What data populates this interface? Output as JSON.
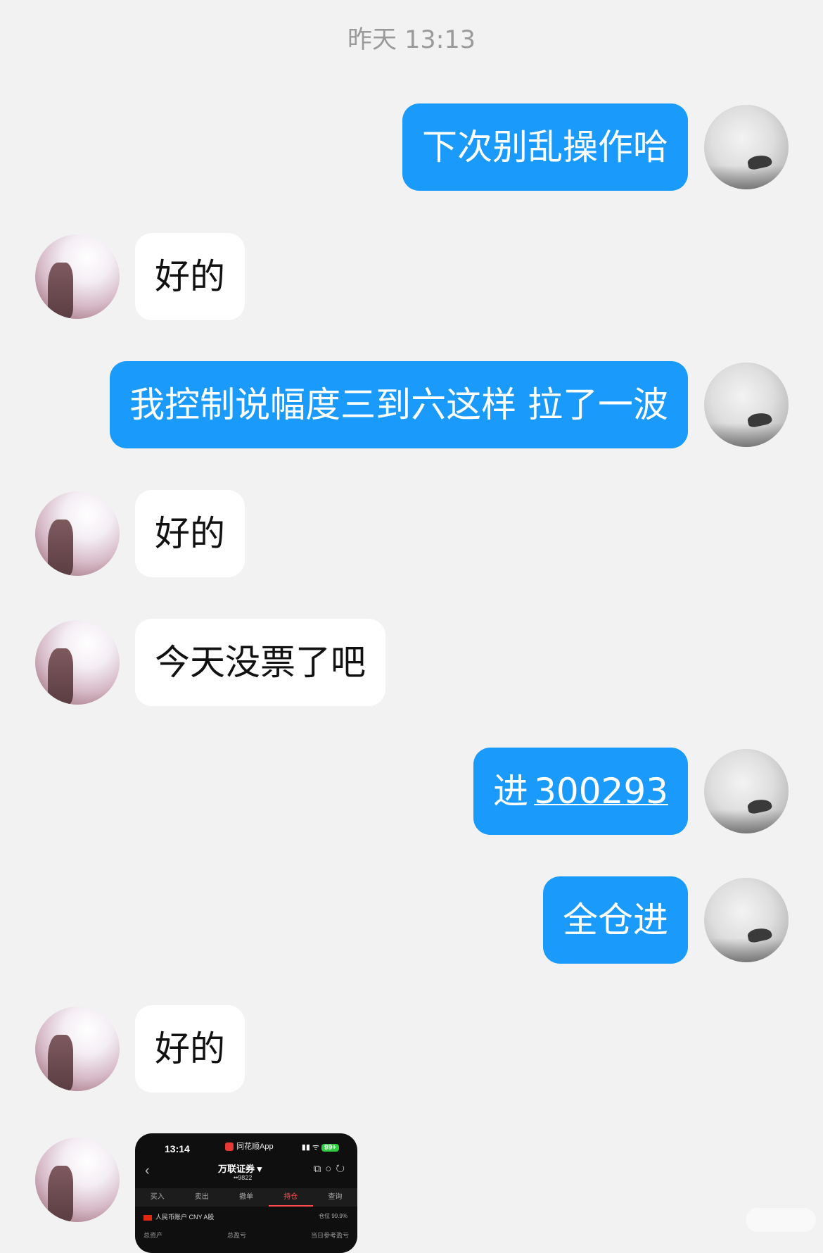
{
  "chat": {
    "timestamp": "昨天 13:13",
    "messages": [
      {
        "from": "me",
        "text": "下次别乱操作哈"
      },
      {
        "from": "them",
        "text": "好的"
      },
      {
        "from": "me",
        "text": "我控制说幅度三到六这样 拉了一波"
      },
      {
        "from": "them",
        "text": "好的"
      },
      {
        "from": "them",
        "text": "今天没票了吧"
      },
      {
        "from": "me",
        "text": "进",
        "link": "300293"
      },
      {
        "from": "me",
        "text": "全仓进"
      },
      {
        "from": "them",
        "text": "好的"
      }
    ],
    "image_message": {
      "time": "13:14",
      "app_name": "同花顺App",
      "battery": "99+",
      "broker": "万联证券",
      "account": "••9822",
      "tabs": [
        "买入",
        "卖出",
        "撤单",
        "持仓",
        "查询"
      ],
      "active_tab": "持仓",
      "account_line": "人民币账户 CNY A股",
      "position_label": "仓位 99.9%",
      "stat_labels": [
        "总资产",
        "总盈亏",
        "当日参考盈亏"
      ]
    }
  }
}
